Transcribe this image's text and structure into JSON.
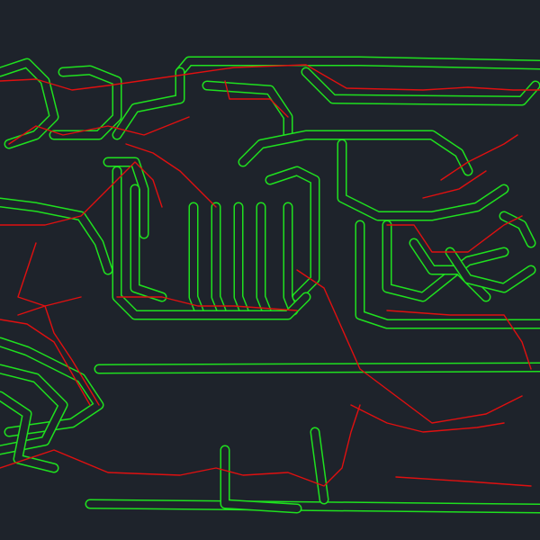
{
  "view": "pcb-routing-canvas",
  "colors": {
    "background": "#1e232b",
    "copper_outline": "#1fe01f",
    "ratsnest": "#e01010"
  },
  "layers": [
    "copper-outline",
    "ratsnest"
  ]
}
